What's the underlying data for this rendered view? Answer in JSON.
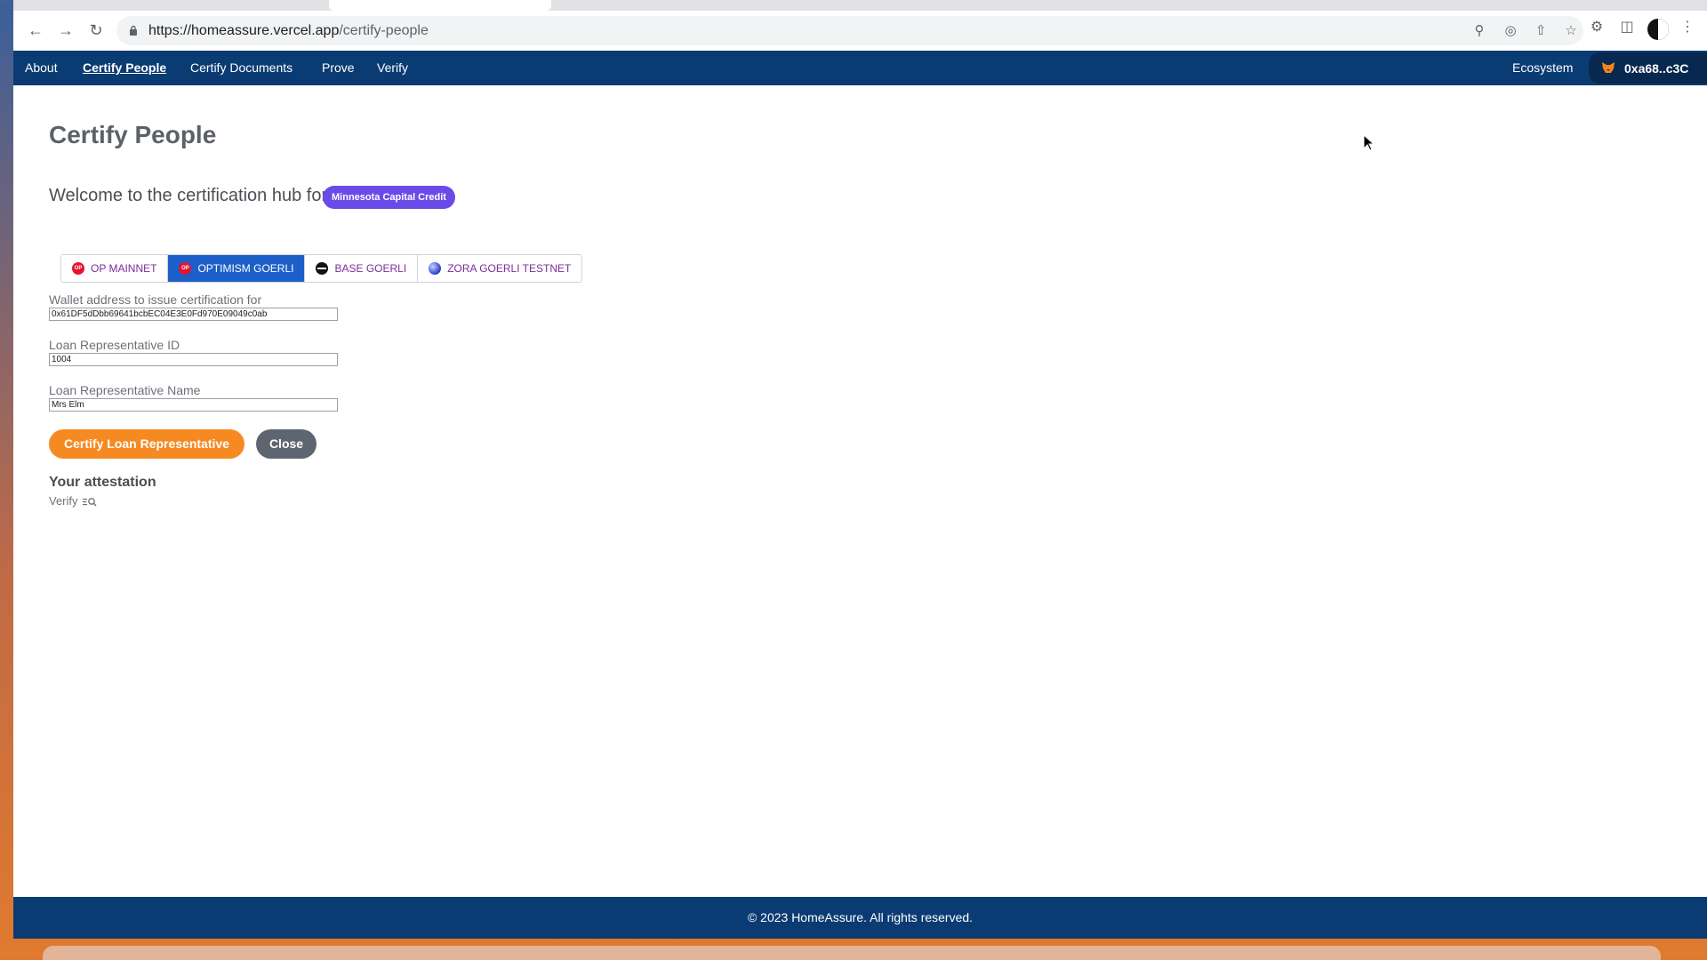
{
  "browser": {
    "url_host": "https://homeassure.vercel.app",
    "url_path": "/certify-people"
  },
  "nav": {
    "links": [
      "About",
      "Certify People",
      "Certify Documents",
      "Prove",
      "Verify"
    ],
    "ecosystem": "Ecosystem",
    "wallet": "0xa68..c3C"
  },
  "page": {
    "title": "Certify People",
    "welcome": "Welcome to the certification hub for",
    "org": "Minnesota Capital Credit"
  },
  "networks": [
    {
      "label": "OP MAINNET",
      "icon": "op-icon",
      "color": "#e8112d",
      "selected": false
    },
    {
      "label": "OPTIMISM GOERLI",
      "icon": "op-icon",
      "color": "#e8112d",
      "selected": true
    },
    {
      "label": "BASE GOERLI",
      "icon": "base-icon",
      "color": "#111111",
      "selected": false
    },
    {
      "label": "ZORA GOERLI TESTNET",
      "icon": "zora-icon",
      "color": "#3b4fd6",
      "selected": false
    }
  ],
  "form": {
    "wallet_label": "Wallet address to issue certification for",
    "wallet_value": "0x61DF5dDbb69641bcbEC04E3E0Fd970E09049c0ab",
    "id_label": "Loan Representative ID",
    "id_value": "1004",
    "name_label": "Loan Representative Name",
    "name_value": "Mrs Elm"
  },
  "buttons": {
    "certify": "Certify Loan Representative",
    "close": "Close"
  },
  "attestation": {
    "title": "Your attestation",
    "verify": "Verify"
  },
  "footer": "© 2023 HomeAssure. All rights reserved.",
  "colors": {
    "nav_bg": "#0b3b73",
    "accent": "#f58a23",
    "badge": "#6a4be8",
    "selected_tab": "#1d5fc9"
  }
}
